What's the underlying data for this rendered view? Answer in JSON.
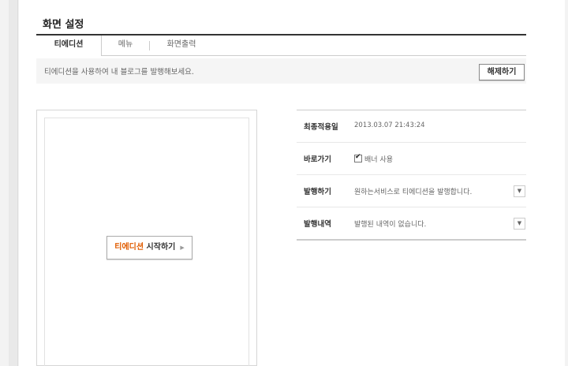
{
  "page": {
    "title": "화면 설정"
  },
  "tabs": [
    {
      "label": "티에디션"
    },
    {
      "label": "메뉴"
    },
    {
      "label": "화면출력"
    }
  ],
  "infobar": {
    "message": "티에디션을 사용하여 내 블로그를 발행해보세요.",
    "release_label": "해제하기"
  },
  "preview": {
    "start_brand": "티에디션",
    "start_rest": " 시작하기",
    "start_arrow": "▶"
  },
  "settings": {
    "last_applied": {
      "label": "최종적용일",
      "value": "2013.03.07 21:43:24"
    },
    "shortcut": {
      "label": "바로가기",
      "value": "배너 사용"
    },
    "publish": {
      "label": "발행하기",
      "value": "원하는서비스로 티에디션을 발행합니다."
    },
    "history": {
      "label": "발행내역",
      "value": "발행된 내역이 없습니다."
    }
  },
  "icons": {
    "dropdown": "▼"
  }
}
